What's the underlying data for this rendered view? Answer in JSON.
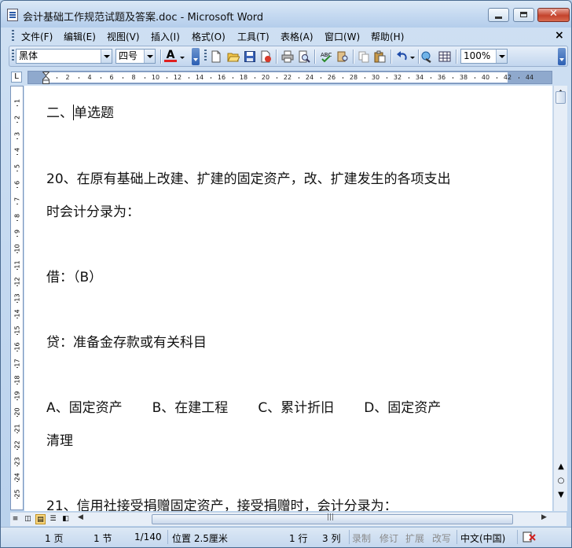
{
  "window": {
    "title": "会计基础工作规范试题及答案.doc - Microsoft Word"
  },
  "menu": [
    "文件(F)",
    "编辑(E)",
    "视图(V)",
    "插入(I)",
    "格式(O)",
    "工具(T)",
    "表格(A)",
    "窗口(W)",
    "帮助(H)"
  ],
  "menu_close": "×",
  "toolbar": {
    "font": "黑体",
    "size": "四号",
    "zoom": "100%",
    "font_color": "#e02020"
  },
  "ruler": {
    "corner": "L",
    "ticks": [
      "2",
      "4",
      "6",
      "8",
      "10",
      "12",
      "14",
      "16",
      "18",
      "20",
      "22",
      "24",
      "26",
      "28",
      "30",
      "32",
      "34",
      "36",
      "38",
      "40",
      "42",
      "44"
    ],
    "vticks": [
      "1",
      "2",
      "3",
      "4",
      "5",
      "6",
      "7",
      "8",
      "9",
      "10",
      "11",
      "12",
      "13",
      "14",
      "15",
      "16",
      "17",
      "18",
      "19",
      "20",
      "21",
      "22",
      "23",
      "24",
      "25"
    ]
  },
  "document": {
    "heading": "二、单选题",
    "heading_before_cursor": "二、",
    "heading_after_cursor": "单选题",
    "q20_line1": "20、在原有基础上改建、扩建的固定资产，改、扩建发生的各项支出",
    "q20_line2": "时会计分录为：",
    "debit": "借：（B）",
    "credit": "贷：准备金存款或有关科目",
    "option_a": "A、固定资产",
    "option_b": "B、在建工程",
    "option_c": "C、累计折旧",
    "option_d": "D、固定资产",
    "option_d_cont": "清理",
    "q21_line1": "21、信用社接受捐赠固定资产，接受捐赠时，会计分录为："
  },
  "status": {
    "page": "1 页",
    "section": "1 节",
    "pages": "1/140",
    "position": "位置 2.5厘米",
    "line": "1 行",
    "column": "3 列",
    "rec": "录制",
    "trk": "修订",
    "ext": "扩展",
    "ovr": "改写",
    "lang": "中文(中国)"
  }
}
